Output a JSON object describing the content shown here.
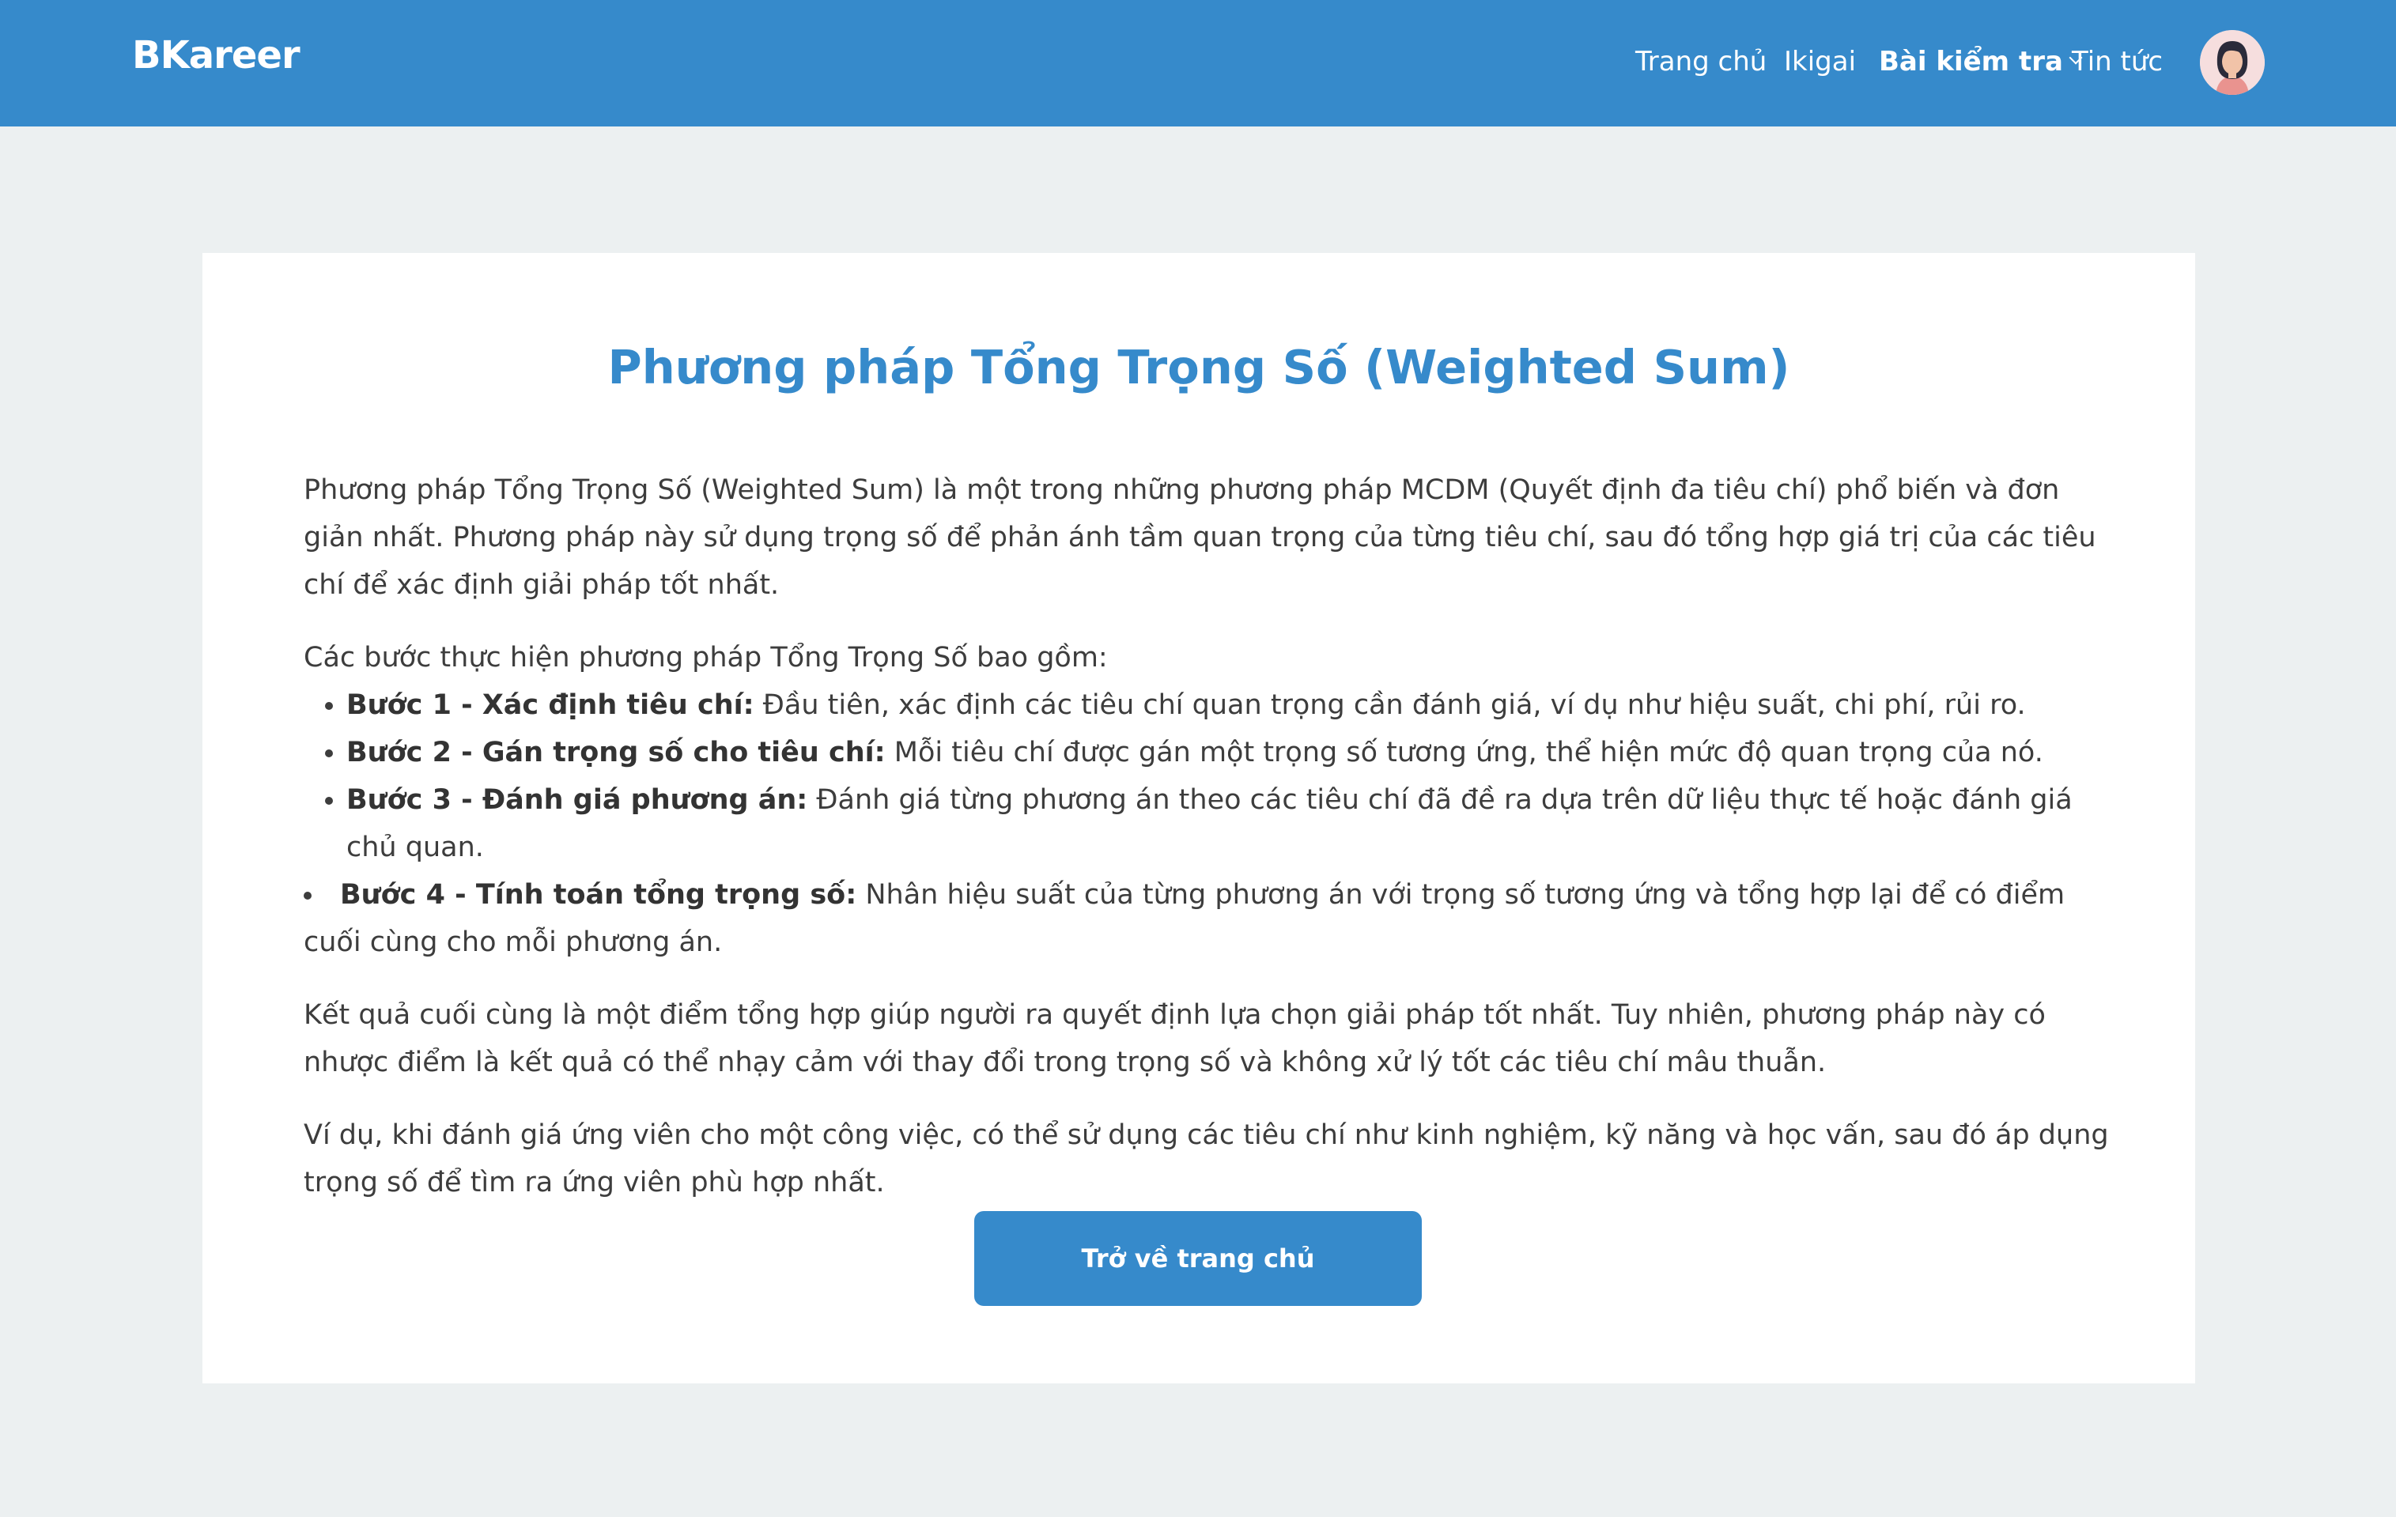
{
  "header": {
    "logo": "BKareer",
    "nav": [
      {
        "label": "Trang chủ"
      },
      {
        "label": "Ikigai"
      },
      {
        "label": "Bài kiểm tra"
      },
      {
        "label": "Tin tức"
      }
    ]
  },
  "article": {
    "title": "Phương pháp Tổng Trọng Số (Weighted Sum)",
    "intro": "Phương pháp Tổng Trọng Số (Weighted Sum) là một trong những phương pháp MCDM (Quyết định đa tiêu chí) phổ biến và đơn giản nhất. Phương pháp này sử dụng trọng số để phản ánh tầm quan trọng của từng tiêu chí, sau đó tổng hợp giá trị của các tiêu chí để xác định giải pháp tốt nhất.",
    "steps_intro": "Các bước thực hiện phương pháp Tổng Trọng Số bao gồm:",
    "steps": [
      {
        "title": "Bước 1 - Xác định tiêu chí:",
        "text": " Đầu tiên, xác định các tiêu chí quan trọng cần đánh giá, ví dụ như hiệu suất, chi phí, rủi ro."
      },
      {
        "title": "Bước 2 - Gán trọng số cho tiêu chí:",
        "text": " Mỗi tiêu chí được gán một trọng số tương ứng, thể hiện mức độ quan trọng của nó."
      },
      {
        "title": "Bước 3 - Đánh giá phương án:",
        "text": " Đánh giá từng phương án theo các tiêu chí đã đề ra dựa trên dữ liệu thực tế hoặc đánh giá chủ quan."
      },
      {
        "title": "Bước 4 - Tính toán tổng trọng số:",
        "text": " Nhân hiệu suất của từng phương án với trọng số tương ứng và tổng hợp lại để có điểm cuối cùng cho mỗi phương án."
      }
    ],
    "conclusion": "Kết quả cuối cùng là một điểm tổng hợp giúp người ra quyết định lựa chọn giải pháp tốt nhất. Tuy nhiên, phương pháp này có nhược điểm là kết quả có thể nhạy cảm với thay đổi trong trọng số và không xử lý tốt các tiêu chí mâu thuẫn.",
    "example": "Ví dụ, khi đánh giá ứng viên cho một công việc, có thể sử dụng các tiêu chí như kinh nghiệm, kỹ năng và học vấn, sau đó áp dụng trọng số để tìm ra ứng viên phù hợp nhất.",
    "back_button": "Trở về trang chủ"
  },
  "colors": {
    "brand": "#368acb",
    "background": "#ecf0f1",
    "text": "#3d3d3d"
  }
}
